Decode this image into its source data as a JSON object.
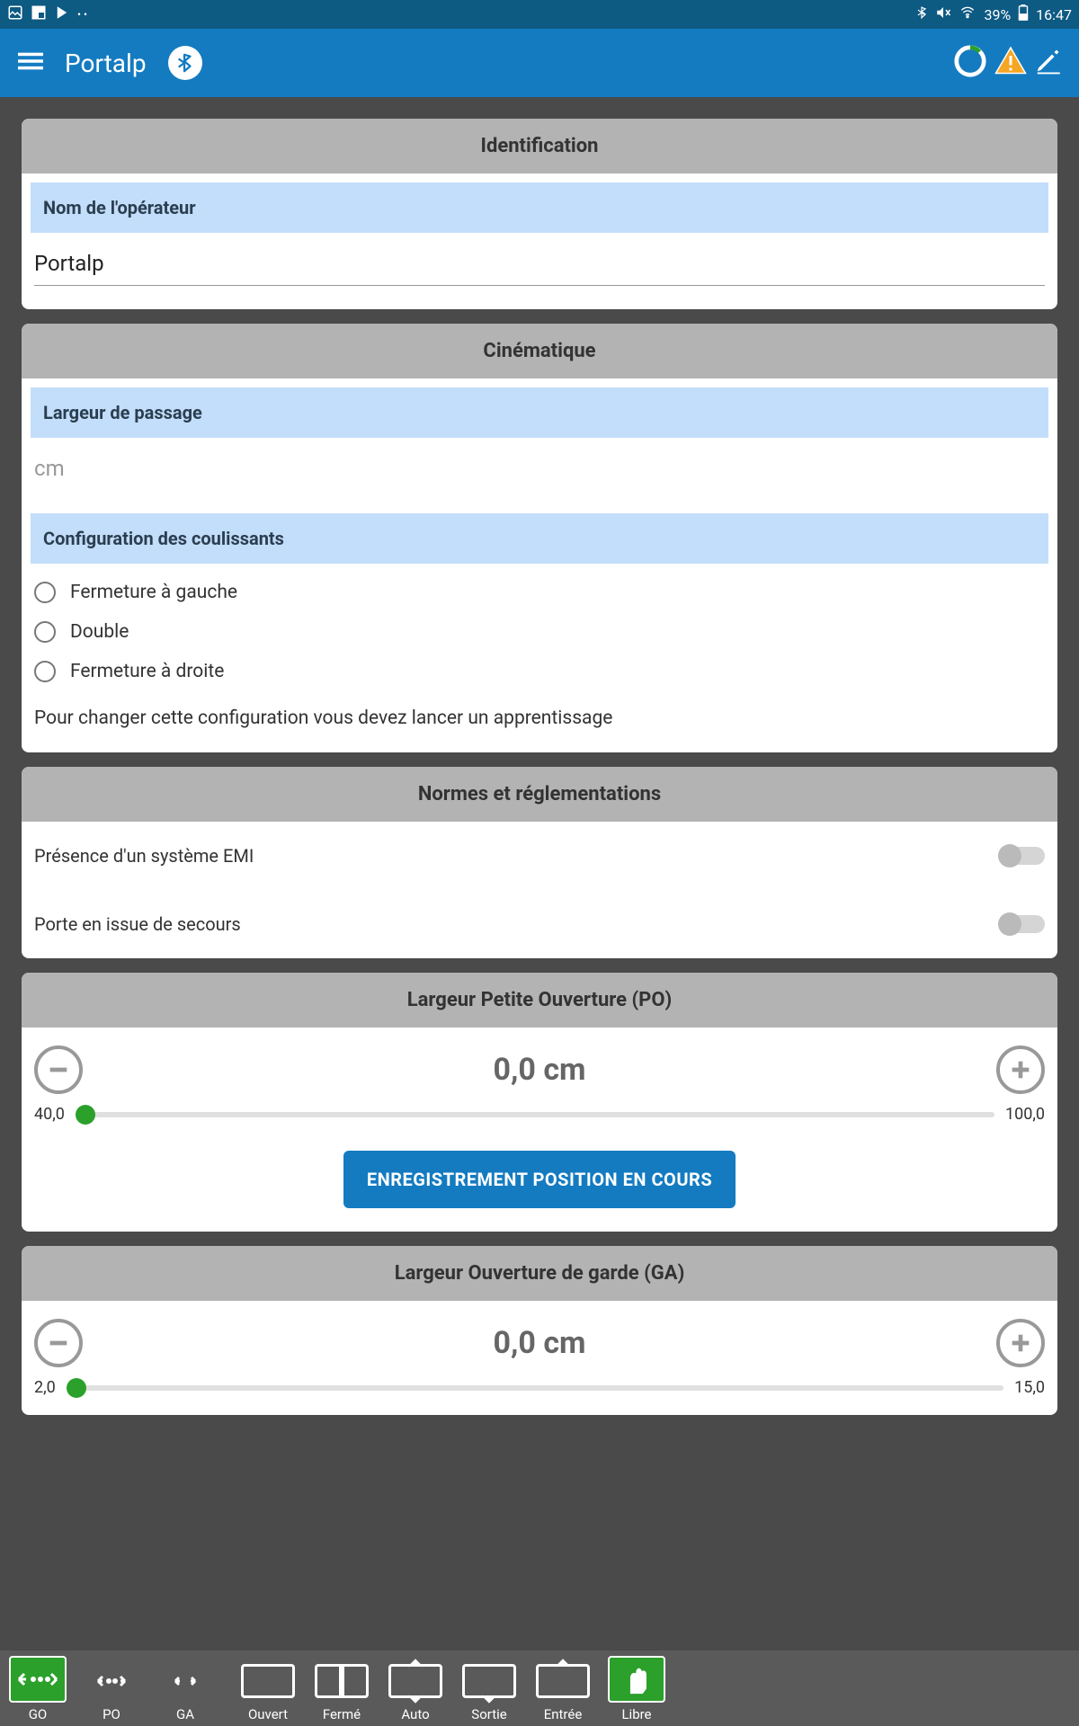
{
  "status": {
    "battery": "39%",
    "time": "16:47"
  },
  "app": {
    "title": "Portalp"
  },
  "identification": {
    "header": "Identification",
    "operator_label": "Nom de l'opérateur",
    "operator_value": "Portalp"
  },
  "cinematique": {
    "header": "Cinématique",
    "width_label": "Largeur de passage",
    "width_placeholder": "cm",
    "config_label": "Configuration des coulissants",
    "opt_left": "Fermeture à gauche",
    "opt_double": "Double",
    "opt_right": "Fermeture à droite",
    "hint": "Pour changer cette configuration vous devez lancer un apprentissage"
  },
  "norms": {
    "header": "Normes et réglementations",
    "emi": "Présence d'un système EMI",
    "emergency": "Porte en issue de secours"
  },
  "po": {
    "header": "Largeur Petite Ouverture (PO)",
    "value": "0,0 cm",
    "min": "40,0",
    "max": "100,0",
    "save_btn": "ENREGISTREMENT POSITION EN COURS"
  },
  "ga": {
    "header": "Largeur Ouverture de garde (GA)",
    "value": "0,0 cm",
    "min": "2,0",
    "max": "15,0"
  },
  "bottom": {
    "go": "GO",
    "po": "PO",
    "ga": "GA",
    "ouvert": "Ouvert",
    "ferme": "Fermé",
    "auto": "Auto",
    "sortie": "Sortie",
    "entree": "Entrée",
    "libre": "Libre"
  }
}
